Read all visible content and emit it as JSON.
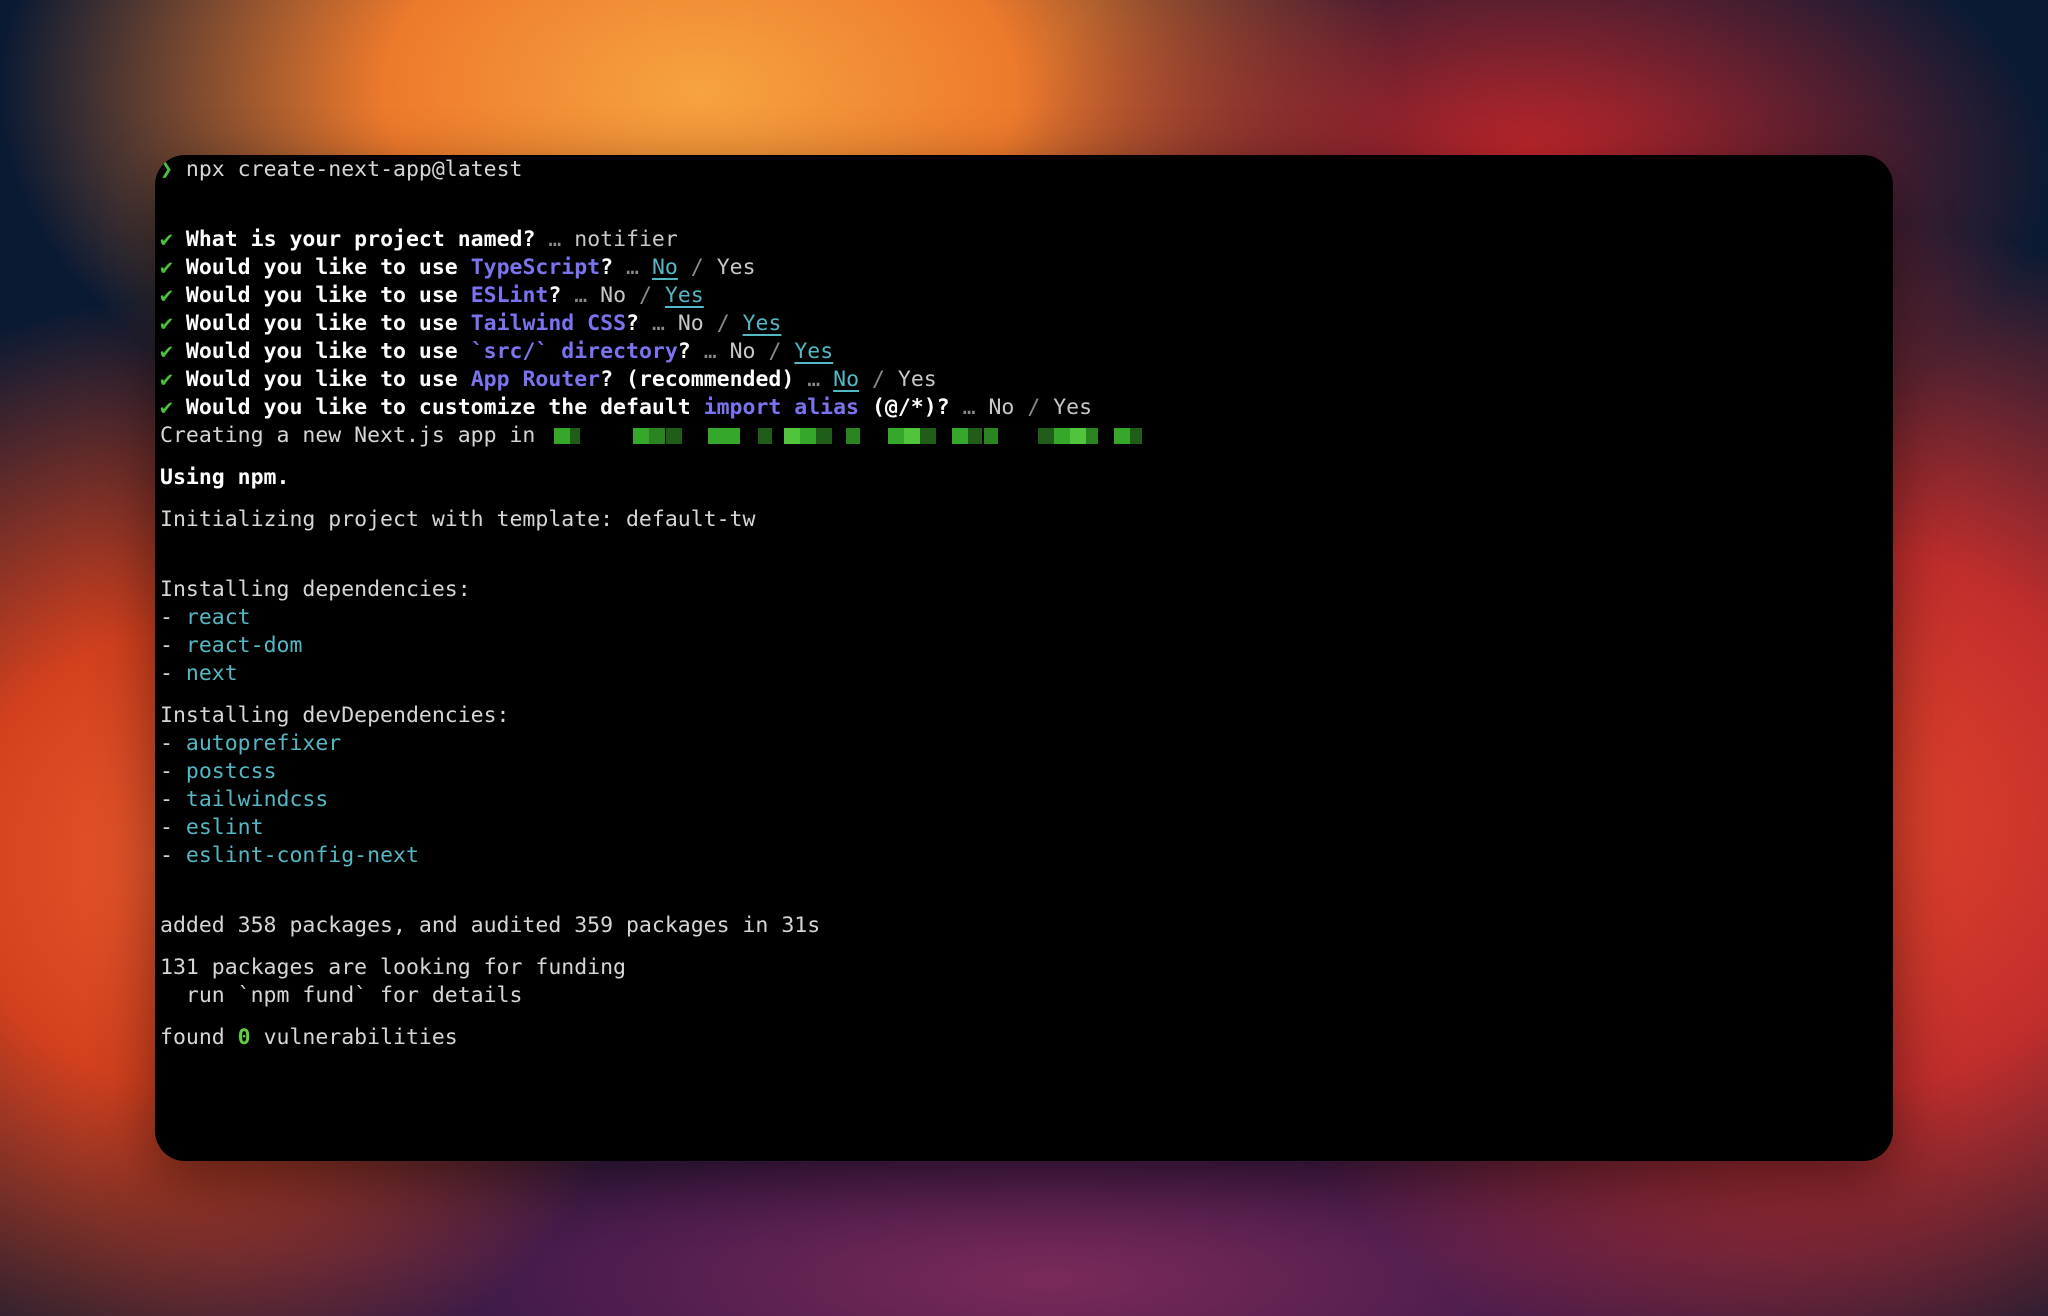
{
  "prompt": {
    "symbol": "❯",
    "command": "npx create-next-app@latest"
  },
  "questions": [
    {
      "check": "✔",
      "q_pre": "What is your project named?",
      "hl": "",
      "q_post": "",
      "answer": "notifier",
      "options": null
    },
    {
      "check": "✔",
      "q_pre": "Would you like to use ",
      "hl": "TypeScript",
      "q_post": "?",
      "answer": "",
      "options": {
        "no": "No",
        "sep": "/",
        "yes": "Yes",
        "selected": "no"
      }
    },
    {
      "check": "✔",
      "q_pre": "Would you like to use ",
      "hl": "ESLint",
      "q_post": "?",
      "answer": "",
      "options": {
        "no": "No",
        "sep": "/",
        "yes": "Yes",
        "selected": "yes"
      }
    },
    {
      "check": "✔",
      "q_pre": "Would you like to use ",
      "hl": "Tailwind CSS",
      "q_post": "?",
      "answer": "",
      "options": {
        "no": "No",
        "sep": "/",
        "yes": "Yes",
        "selected": "yes"
      }
    },
    {
      "check": "✔",
      "q_pre": "Would you like to use ",
      "hl": "`src/` directory",
      "q_post": "?",
      "answer": "",
      "options": {
        "no": "No",
        "sep": "/",
        "yes": "Yes",
        "selected": "yes"
      }
    },
    {
      "check": "✔",
      "q_pre": "Would you like to use ",
      "hl": "App Router",
      "q_post": "? (recommended)",
      "answer": "",
      "options": {
        "no": "No",
        "sep": "/",
        "yes": "Yes",
        "selected": "no"
      }
    },
    {
      "check": "✔",
      "q_pre": "Would you like to customize the default ",
      "hl": "import alias",
      "q_post": " (@/*)?",
      "answer": "",
      "options": {
        "no": "No",
        "sep": "/",
        "yes": "Yes",
        "selected": "none"
      }
    }
  ],
  "ellipsis": "…",
  "creating": "Creating a new Next.js app in",
  "using": "Using npm.",
  "init": "Initializing project with template: default-tw",
  "deps_header": "Installing dependencies:",
  "deps": [
    "react",
    "react-dom",
    "next"
  ],
  "devdeps_header": "Installing devDependencies:",
  "devdeps": [
    "autoprefixer",
    "postcss",
    "tailwindcss",
    "eslint",
    "eslint-config-next"
  ],
  "dash": "-",
  "added": "added 358 packages, and audited 359 packages in 31s",
  "funding": "131 packages are looking for funding",
  "fund_hint": "  run `npm fund` for details",
  "found": {
    "pre": "found ",
    "count": "0",
    "post": " vulnerabilities"
  },
  "colors": {
    "check": "#4cc13a",
    "highlight": "#7b73f0",
    "package": "#54b8c4",
    "terminal_bg": "#000000"
  }
}
